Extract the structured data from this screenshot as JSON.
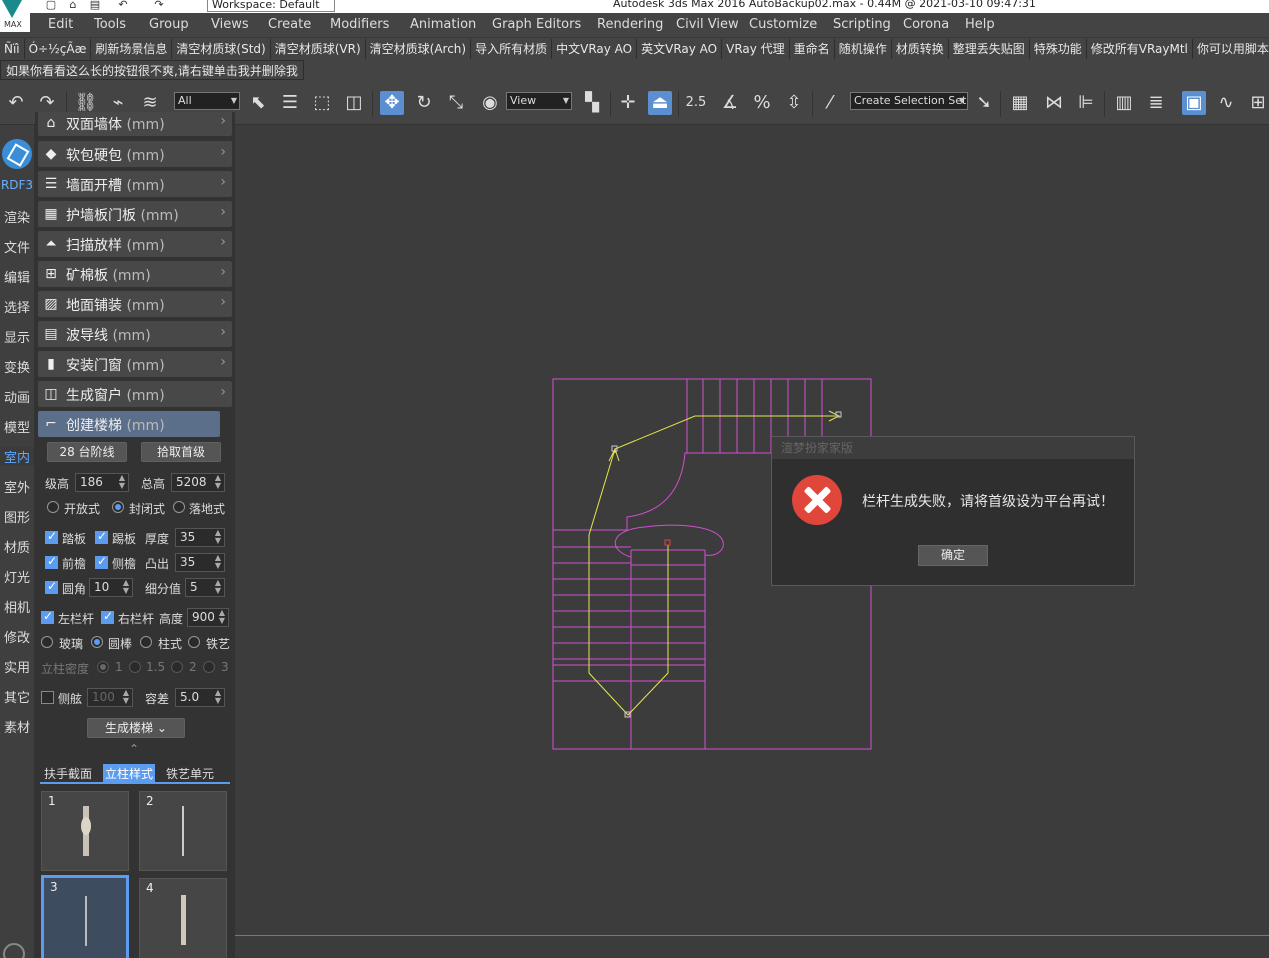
{
  "titlebar": {
    "workspace": "Workspace: Default",
    "title": "Autodesk 3ds Max 2016     AutoBackup02.max - 0.44M @ 2021-03-10 09:47:31",
    "logo_text": "MAX"
  },
  "menu": [
    "Edit",
    "Tools",
    "Group",
    "Views",
    "Create",
    "Modifiers",
    "Animation",
    "Graph Editors",
    "Rendering",
    "Civil View",
    "Customize",
    "Scripting",
    "Corona",
    "Help"
  ],
  "plugin_bar": [
    "Ñïì",
    "Ó÷½çÃæ",
    "刷新场景信息",
    "清空材质球(Std)",
    "清空材质球(VR)",
    "清空材质球(Arch)",
    "导入所有材质",
    "中文VRay AO",
    "英文VRay AO",
    "VRay 代理",
    "重命名",
    "随机操作",
    "材质转换",
    "整理丢失贴图",
    "特殊功能",
    "修改所有VRayMtl",
    "你可以用脚本"
  ],
  "hint": "如果你看看这么长的按钮很不爽,请右键单击我并删除我",
  "toolbar": {
    "filter": "All",
    "view": "View",
    "selection_set": "Create Selection Set",
    "snap_value": "2.5"
  },
  "left_strip": [
    "RDF3",
    "渲染",
    "文件",
    "编辑",
    "选择",
    "显示",
    "变换",
    "动画",
    "模型",
    "室内",
    "室外",
    "图形",
    "材质",
    "灯光",
    "相机",
    "修改",
    "实用",
    "其它",
    "素材"
  ],
  "panel": {
    "rows": [
      {
        "label": "双面墙体",
        "unit": "(mm)",
        "icon": "house-icon"
      },
      {
        "label": "软包硬包",
        "unit": "(mm)",
        "icon": "diamond-icon"
      },
      {
        "label": "墙面开槽",
        "unit": "(mm)",
        "icon": "lines-icon"
      },
      {
        "label": "护墙板门板",
        "unit": "(mm)",
        "icon": "panel-icon"
      },
      {
        "label": "扫描放样",
        "unit": "(mm)",
        "icon": "sweep-icon"
      },
      {
        "label": "矿棉板",
        "unit": "(mm)",
        "icon": "grid-icon"
      },
      {
        "label": "地面铺装",
        "unit": "(mm)",
        "icon": "floor-icon"
      },
      {
        "label": "波导线",
        "unit": "(mm)",
        "icon": "wave-icon"
      },
      {
        "label": "安装门窗",
        "unit": "(mm)",
        "icon": "door-icon"
      },
      {
        "label": "生成窗户",
        "unit": "(mm)",
        "icon": "window-icon"
      },
      {
        "label": "创建楼梯",
        "unit": "(mm)",
        "icon": "stairs-icon"
      }
    ],
    "steps_btn": "28 台阶线",
    "first_btn": "拾取首级",
    "step_h_label": "级高",
    "step_h": "186",
    "total_h_label": "总高",
    "total_h": "5208",
    "open_type": "开放式",
    "closed_type": "封闭式",
    "floor_type": "落地式",
    "tread": "踏板",
    "riser": "踢板",
    "thick_label": "厚度",
    "thick": "35",
    "nosing": "前檐",
    "side": "侧檐",
    "protrude_label": "凸出",
    "protrude": "35",
    "round": "圆角",
    "round_val": "10",
    "subdiv_label": "细分值",
    "subdiv": "5",
    "left_rail": "左栏杆",
    "right_rail": "右栏杆",
    "height_label": "高度",
    "height": "900",
    "glass": "玻璃",
    "round_bar": "圆棒",
    "column": "柱式",
    "iron": "铁艺",
    "density_label": "立柱密度",
    "d1": "1",
    "d15": "1.5",
    "d2": "2",
    "d3": "3",
    "side_board": "侧舷",
    "side_val": "100",
    "tol_label": "容差",
    "tol": "5.0",
    "generate": "生成楼梯",
    "tabs": [
      "扶手截面",
      "立柱样式",
      "铁艺单元"
    ],
    "thumbs": [
      "1",
      "2",
      "3",
      "4"
    ]
  },
  "dialog": {
    "title": "渲梦扮家家版",
    "message": "栏杆生成失败，请将首级设为平台再试！",
    "ok": "确定"
  }
}
